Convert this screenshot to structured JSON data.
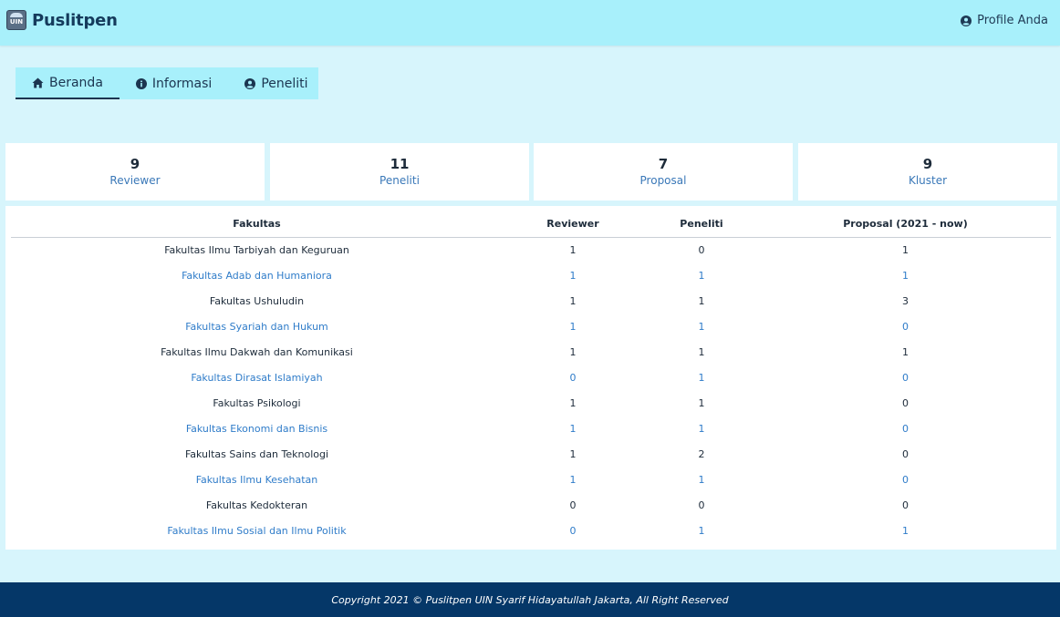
{
  "header": {
    "logo_text": "UIN",
    "app_name": "Puslitpen",
    "profile_label": "Profile Anda"
  },
  "nav": {
    "tabs": [
      {
        "label": "Beranda",
        "icon": "home-icon",
        "active": true
      },
      {
        "label": "Informasi",
        "icon": "info-circle-icon",
        "active": false
      },
      {
        "label": "Peneliti",
        "icon": "user-circle-icon",
        "active": false
      }
    ]
  },
  "stats": [
    {
      "value": "9",
      "label": "Reviewer"
    },
    {
      "value": "11",
      "label": "Peneliti"
    },
    {
      "value": "7",
      "label": "Proposal"
    },
    {
      "value": "9",
      "label": "Kluster"
    }
  ],
  "table": {
    "headers": [
      "Fakultas",
      "Reviewer",
      "Peneliti",
      "Proposal (2021 - now)"
    ],
    "rows": [
      [
        "Fakultas Ilmu Tarbiyah dan Keguruan",
        "1",
        "0",
        "1"
      ],
      [
        "Fakultas Adab dan Humaniora",
        "1",
        "1",
        "1"
      ],
      [
        "Fakultas Ushuludin",
        "1",
        "1",
        "3"
      ],
      [
        "Fakultas Syariah dan Hukum",
        "1",
        "1",
        "0"
      ],
      [
        "Fakultas Ilmu Dakwah dan Komunikasi",
        "1",
        "1",
        "1"
      ],
      [
        "Fakultas Dirasat Islamiyah",
        "0",
        "1",
        "0"
      ],
      [
        "Fakultas Psikologi",
        "1",
        "1",
        "0"
      ],
      [
        "Fakultas Ekonomi dan Bisnis",
        "1",
        "1",
        "0"
      ],
      [
        "Fakultas Sains dan Teknologi",
        "1",
        "2",
        "0"
      ],
      [
        "Fakultas Ilmu Kesehatan",
        "1",
        "1",
        "0"
      ],
      [
        "Fakultas Kedokteran",
        "0",
        "0",
        "0"
      ],
      [
        "Fakultas Ilmu Sosial dan Ilmu Politik",
        "0",
        "1",
        "1"
      ]
    ]
  },
  "footer": {
    "copyright": "Copyright 2021 © Puslitpen UIN Syarif Hidayatullah Jakarta, All Right Reserved"
  },
  "colors": {
    "header_bg": "#a8f0fb",
    "page_bg": "#d7f5fc",
    "footer_bg": "#053768",
    "link_blue": "#2f7cc9"
  }
}
